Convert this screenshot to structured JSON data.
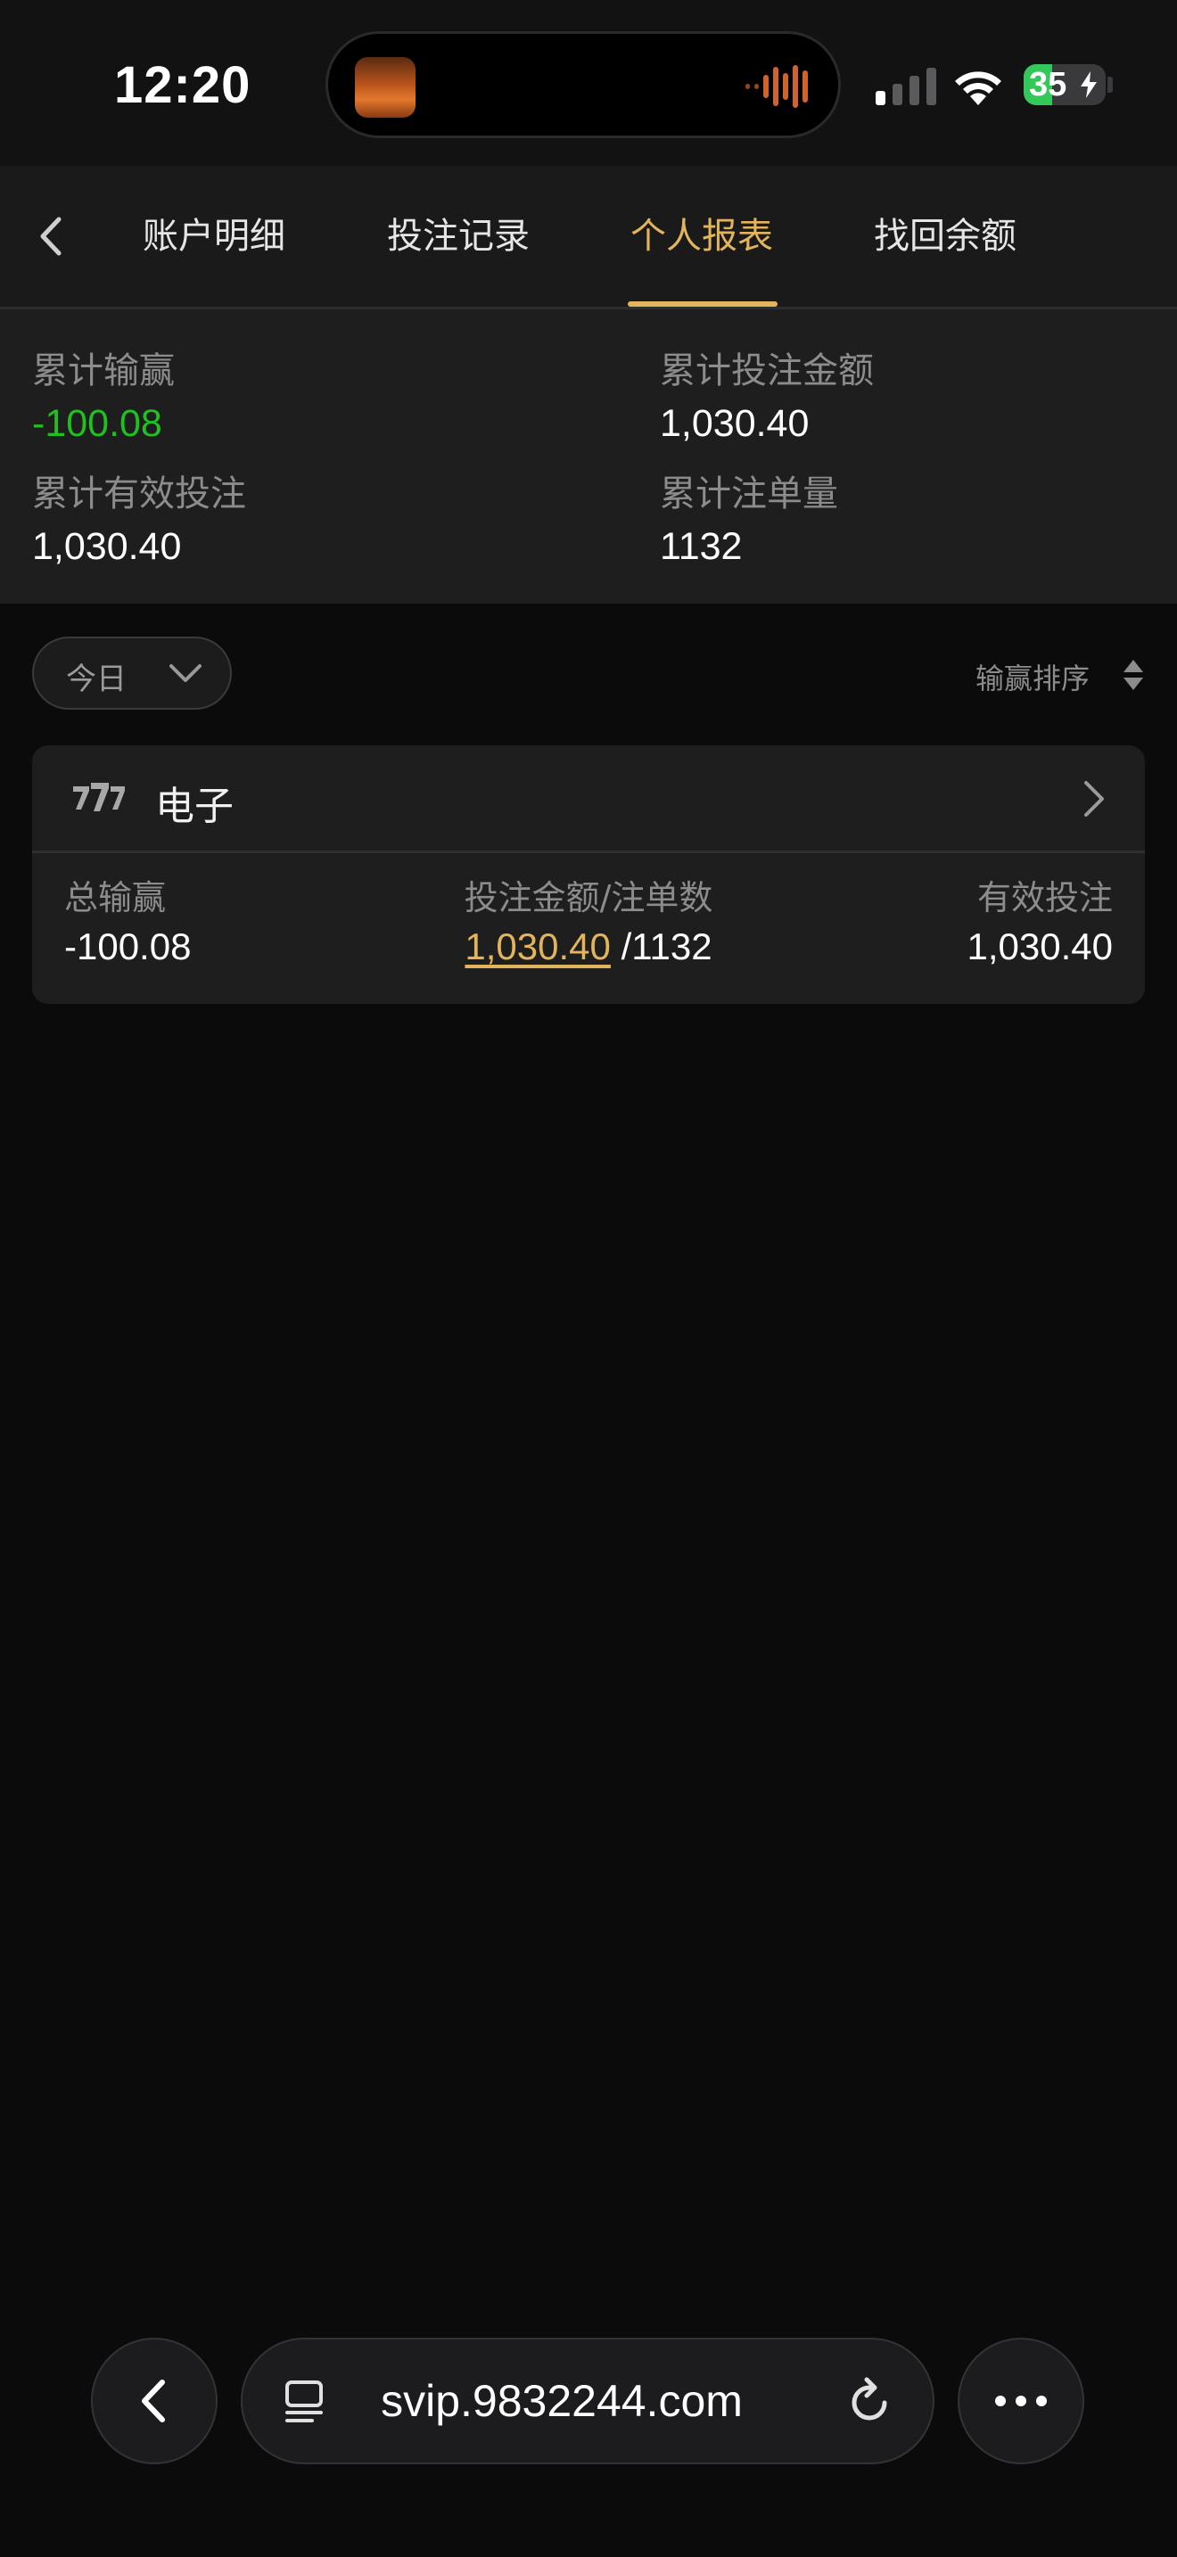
{
  "status_bar": {
    "time": "12:20",
    "battery_percent": "35",
    "battery_level": 0.35,
    "signal_bars_active": 1
  },
  "tabs": [
    {
      "label": "账户明细",
      "active": false
    },
    {
      "label": "投注记录",
      "active": false
    },
    {
      "label": "个人报表",
      "active": true
    },
    {
      "label": "找回余额",
      "active": false
    }
  ],
  "summary": {
    "total_win_loss_label": "累计输赢",
    "total_win_loss_value": "-100.08",
    "total_bet_amount_label": "累计投注金额",
    "total_bet_amount_value": "1,030.40",
    "total_valid_bet_label": "累计有效投注",
    "total_valid_bet_value": "1,030.40",
    "total_bet_count_label": "累计注单量",
    "total_bet_count_value": "1132"
  },
  "filter": {
    "period": "今日",
    "sort_label": "输赢排序"
  },
  "categories": [
    {
      "name": "电子",
      "win_loss_label": "总输赢",
      "win_loss_value": "-100.08",
      "bet_label": "投注金额/注单数",
      "bet_amount": "1,030.40",
      "bet_count": "/1132",
      "valid_bet_label": "有效投注",
      "valid_bet_value": "1,030.40"
    }
  ],
  "browser": {
    "url": "svip.9832244.com"
  },
  "colors": {
    "accent": "#e2b45c",
    "negative_green": "#20c020",
    "background": "#0b0b0b"
  }
}
